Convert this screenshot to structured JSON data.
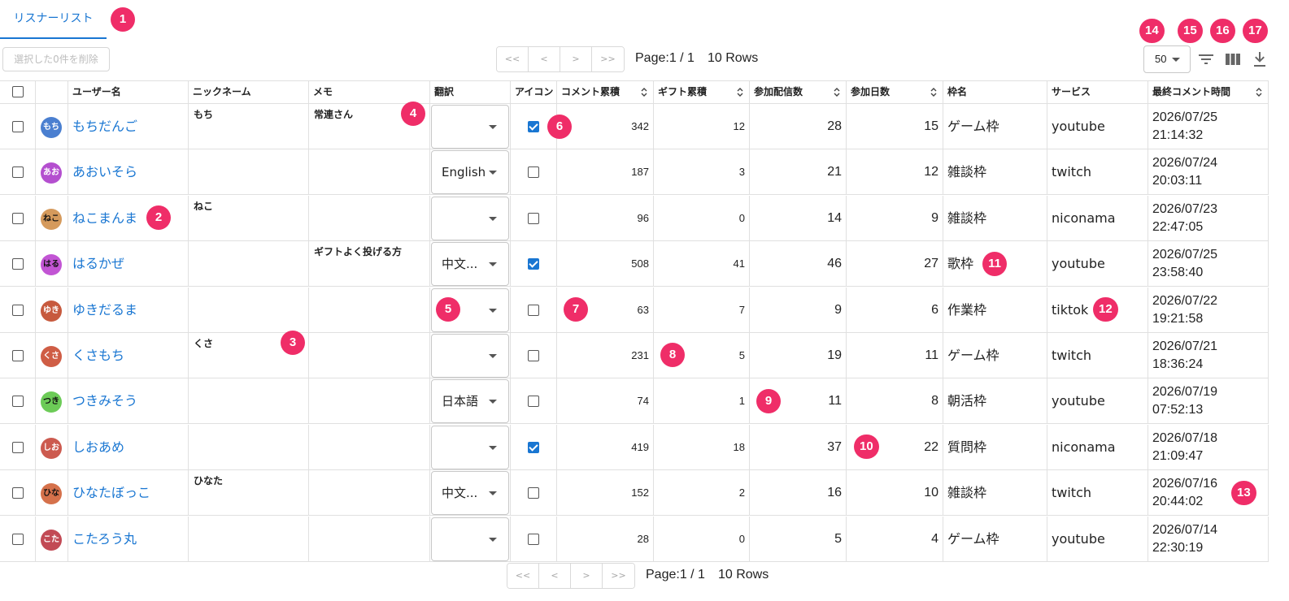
{
  "tab": {
    "label": "リスナーリスト"
  },
  "toolbar": {
    "delete_label": "選択した0件を削除",
    "rows_per_page": "50"
  },
  "pager": {
    "first": "<<",
    "prev": "<",
    "next": ">",
    "last": ">>",
    "page": "Page:1 / 1",
    "rows": "10 Rows"
  },
  "badges": [
    "1",
    "2",
    "3",
    "4",
    "5",
    "6",
    "7",
    "8",
    "9",
    "10",
    "11",
    "12",
    "13",
    "14",
    "15",
    "16",
    "17"
  ],
  "columns": {
    "username": "ユーザー名",
    "nickname": "ニックネーム",
    "memo": "メモ",
    "translate": "翻訳",
    "icon": "アイコン",
    "comments": "コメント累積",
    "gifts": "ギフト累積",
    "streams": "参加配信数",
    "days": "参加日数",
    "frame": "枠名",
    "service": "サービス",
    "last_comment": "最終コメント時間"
  },
  "icons": {
    "filter": "filter-icon",
    "columns": "columns-icon",
    "download": "download-icon",
    "sort": "sort-icon"
  },
  "colors": {
    "accent": "#1976d2",
    "badge": "#ef2d68"
  },
  "rows": [
    {
      "avatar": "もち",
      "avatar_color": "#4a7fd0",
      "username": "もちだんご",
      "nickname": "もち",
      "memo": "常連さん",
      "translate": "",
      "icon_checked": true,
      "comments": "342",
      "gifts": "12",
      "streams": "28",
      "days": "15",
      "frame": "ゲーム枠",
      "service": "youtube",
      "date": "2026/07/25",
      "time": "21:14:32"
    },
    {
      "avatar": "あお",
      "avatar_color": "#b44fcf",
      "username": "あおいそら",
      "nickname": "",
      "memo": "",
      "translate": "English",
      "icon_checked": false,
      "comments": "187",
      "gifts": "3",
      "streams": "21",
      "days": "12",
      "frame": "雑談枠",
      "service": "twitch",
      "date": "2026/07/24",
      "time": "20:03:11"
    },
    {
      "avatar": "ねこ",
      "avatar_color": "#d59a5c",
      "avatar_dark": true,
      "username": "ねこまんま",
      "nickname": "ねこ",
      "memo": "",
      "translate": "",
      "icon_checked": false,
      "comments": "96",
      "gifts": "0",
      "streams": "14",
      "days": "9",
      "frame": "雑談枠",
      "service": "niconama",
      "date": "2026/07/23",
      "time": "22:47:05"
    },
    {
      "avatar": "はる",
      "avatar_color": "#c255d4",
      "avatar_dark": true,
      "username": "はるかぜ",
      "nickname": "",
      "memo": "ギフトよく投げる方",
      "translate": "中文...",
      "icon_checked": true,
      "comments": "508",
      "gifts": "41",
      "streams": "46",
      "days": "27",
      "frame": "歌枠",
      "service": "youtube",
      "date": "2026/07/25",
      "time": "23:58:40"
    },
    {
      "avatar": "ゆき",
      "avatar_color": "#c75a3e",
      "username": "ゆきだるま",
      "nickname": "",
      "memo": "",
      "translate": "",
      "icon_checked": false,
      "comments": "63",
      "gifts": "7",
      "streams": "9",
      "days": "6",
      "frame": "作業枠",
      "service": "tiktok",
      "date": "2026/07/22",
      "time": "19:21:58"
    },
    {
      "avatar": "くさ",
      "avatar_color": "#cf5d45",
      "username": "くさもち",
      "nickname": "くさ",
      "memo": "",
      "translate": "",
      "icon_checked": false,
      "comments": "231",
      "gifts": "5",
      "streams": "19",
      "days": "11",
      "frame": "ゲーム枠",
      "service": "twitch",
      "date": "2026/07/21",
      "time": "18:36:24"
    },
    {
      "avatar": "つき",
      "avatar_color": "#6ccb57",
      "avatar_dark": true,
      "username": "つきみそう",
      "nickname": "",
      "memo": "",
      "translate": "日本語",
      "icon_checked": false,
      "comments": "74",
      "gifts": "1",
      "streams": "11",
      "days": "8",
      "frame": "朝活枠",
      "service": "youtube",
      "date": "2026/07/19",
      "time": "07:52:13"
    },
    {
      "avatar": "しお",
      "avatar_color": "#cc5a4f",
      "username": "しおあめ",
      "nickname": "",
      "memo": "",
      "translate": "",
      "icon_checked": true,
      "comments": "419",
      "gifts": "18",
      "streams": "37",
      "days": "22",
      "frame": "質問枠",
      "service": "niconama",
      "date": "2026/07/18",
      "time": "21:09:47"
    },
    {
      "avatar": "ひな",
      "avatar_color": "#d5714b",
      "avatar_dark": true,
      "username": "ひなたぼっこ",
      "nickname": "ひなた",
      "memo": "",
      "translate": "中文...",
      "icon_checked": false,
      "comments": "152",
      "gifts": "2",
      "streams": "16",
      "days": "10",
      "frame": "雑談枠",
      "service": "twitch",
      "date": "2026/07/16",
      "time": "20:44:02"
    },
    {
      "avatar": "こた",
      "avatar_color": "#c24a55",
      "username": "こたろう丸",
      "nickname": "",
      "memo": "",
      "translate": "",
      "icon_checked": false,
      "comments": "28",
      "gifts": "0",
      "streams": "5",
      "days": "4",
      "frame": "ゲーム枠",
      "service": "youtube",
      "date": "2026/07/14",
      "time": "22:30:19"
    }
  ]
}
